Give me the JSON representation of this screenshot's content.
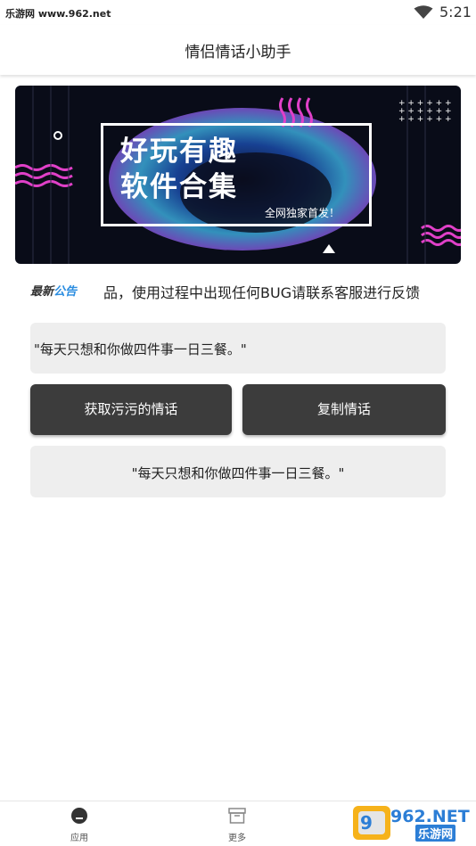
{
  "status_bar": {
    "site_label": "乐游网 www.962.net",
    "time": "5:21",
    "wifi_icon": "wifi-icon"
  },
  "app_bar": {
    "title": "情侣情话小助手"
  },
  "banner": {
    "line1": "好玩有趣",
    "line2": "软件合集",
    "tag": "全网独家首发！"
  },
  "notice": {
    "badge_part1": "最新",
    "badge_part2": "公告",
    "text": "品，使用过程中出现任何BUG请联系客服进行反馈"
  },
  "quote_top": {
    "text": "\"每天只想和你做四件事一日三餐。\""
  },
  "buttons": {
    "get_label": "获取污污的情话",
    "copy_label": "复制情话"
  },
  "quote_bottom": {
    "text": "\"每天只想和你做四件事一日三餐。\""
  },
  "bottom_nav": {
    "items": [
      {
        "label": "应用",
        "icon": "apps-icon"
      },
      {
        "label": "更多",
        "icon": "box-icon"
      }
    ]
  },
  "watermark": {
    "brand": "962.NET",
    "sub": "乐游网"
  },
  "colors": {
    "button_bg": "#3c3c3c",
    "quote_bg": "#eeeeee",
    "banner_bg": "#090c18",
    "accent_pink": "#e040c8",
    "accent_blue": "#2b8de0"
  }
}
